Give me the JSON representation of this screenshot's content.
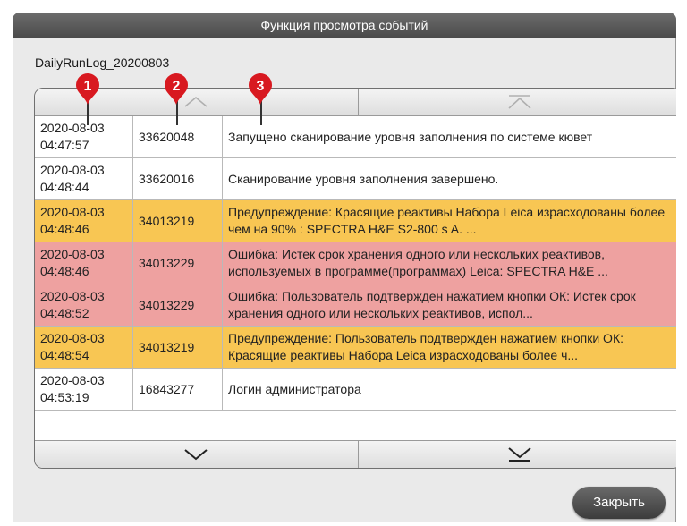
{
  "window": {
    "title": "Функция просмотра событий",
    "filename": "DailyRunLog_20200803"
  },
  "markers": [
    "1",
    "2",
    "3"
  ],
  "colors": {
    "warning_row": "#f8c653",
    "error_row": "#eea1a0",
    "marker": "#d81920"
  },
  "events": [
    {
      "type": "info",
      "time": "2020-08-03\n04:47:57",
      "code": "33620048",
      "message": "Запущено сканирование уровня заполнения по системе кювет"
    },
    {
      "type": "info",
      "time": "2020-08-03\n04:48:44",
      "code": "33620016",
      "message": "Сканирование уровня заполнения завершено."
    },
    {
      "type": "warn",
      "time": "2020-08-03\n04:48:46",
      "code": "34013219",
      "message": "Предупреждение: Красящие реактивы Набора Leica израсходованы более чем на 90% : SPECTRA H&E S2-800 s A. ..."
    },
    {
      "type": "error",
      "time": "2020-08-03\n04:48:46",
      "code": "34013229",
      "message": "Ошибка: Истек срок хранения одного или нескольких реактивов, используемых в программе(программах) Leica: SPECTRA H&E ..."
    },
    {
      "type": "error",
      "time": "2020-08-03\n04:48:52",
      "code": "34013229",
      "message": "Ошибка: Пользователь подтвержден нажатием кнопки ОК: Истек срок хранения одного или нескольких реактивов, испол..."
    },
    {
      "type": "warn",
      "time": "2020-08-03\n04:48:54",
      "code": "34013219",
      "message": "Предупреждение: Пользователь подтвержден нажатием кнопки ОК: Красящие реактивы Набора Leica израсходованы более ч..."
    },
    {
      "type": "info",
      "time": "2020-08-03\n04:53:19",
      "code": "16843277",
      "message": "Логин администратора"
    }
  ],
  "buttons": {
    "close_label": "Закрыть"
  }
}
